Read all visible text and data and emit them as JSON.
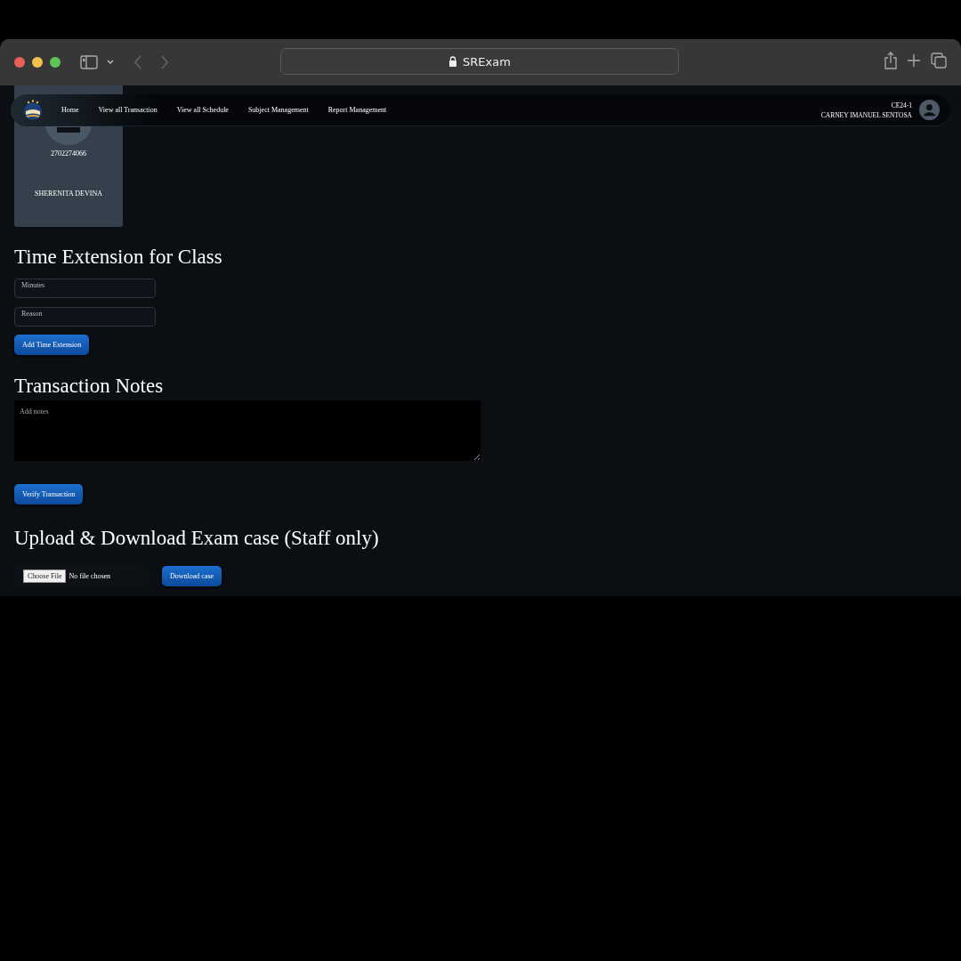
{
  "browser": {
    "address": "SRExam"
  },
  "navbar": {
    "links": [
      "Home",
      "View all Transaction",
      "View all Schedule",
      "Subject Management",
      "Report Management"
    ],
    "user_code": "CE24-1",
    "user_name": "CARNEY IMANUEL SENTOSA"
  },
  "student_card": {
    "id": "2702274066",
    "name": "SHERENITA DEVINA"
  },
  "time_extension": {
    "title": "Time Extension for Class",
    "fields": [
      {
        "label": "Minutes"
      },
      {
        "label": "Reason"
      }
    ],
    "button": "Add Time Extension"
  },
  "transaction_notes": {
    "title": "Transaction Notes",
    "placeholder": "Add notes",
    "button": "Verify Transaction"
  },
  "exam_case": {
    "title": "Upload & Download Exam case (Staff only)",
    "file_button": "Choose File",
    "file_status": "No file chosen",
    "button": "Download case"
  }
}
